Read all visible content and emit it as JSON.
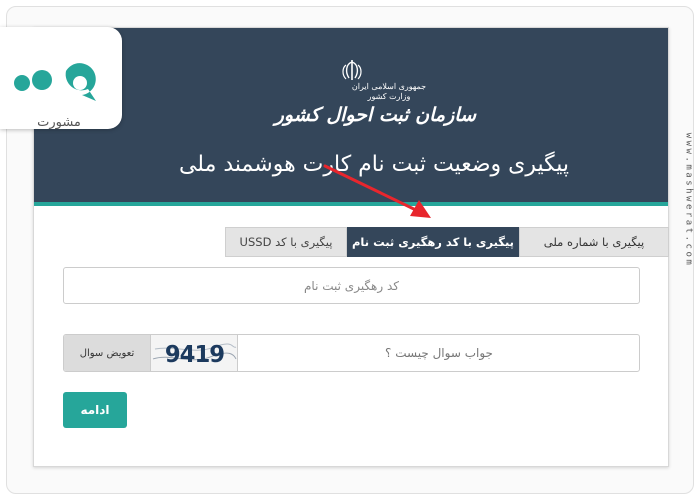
{
  "header": {
    "gov_line_1": "جمهوری اسلامی ایران",
    "gov_line_2": "وزارت کشور",
    "org_name": "سازمان ثبت احوال کشور",
    "page_title": "پیگیری وضعیت ثبت نام کارت هوشمند ملی"
  },
  "tabs": [
    {
      "label": "پیگیری با کد USSD",
      "active": false
    },
    {
      "label": "پیگیری با کد رهگیری ثبت نام",
      "active": true
    },
    {
      "label": "پیگیری با شماره ملی",
      "active": false
    }
  ],
  "form": {
    "tracking_placeholder": "کد رهگیری ثبت نام",
    "captcha_placeholder": "جواب سوال چیست ؟",
    "refresh_label": "تعویض سوال",
    "submit_label": "ادامه"
  },
  "captcha": {
    "text": "9419"
  },
  "watermark": {
    "text": "www.mashwerat.com"
  },
  "logo": {
    "text": "مشورت"
  },
  "colors": {
    "header_bg": "#34465a",
    "accent": "#26a69a",
    "active_tab": "#34465a",
    "arrow": "#e8262d"
  }
}
